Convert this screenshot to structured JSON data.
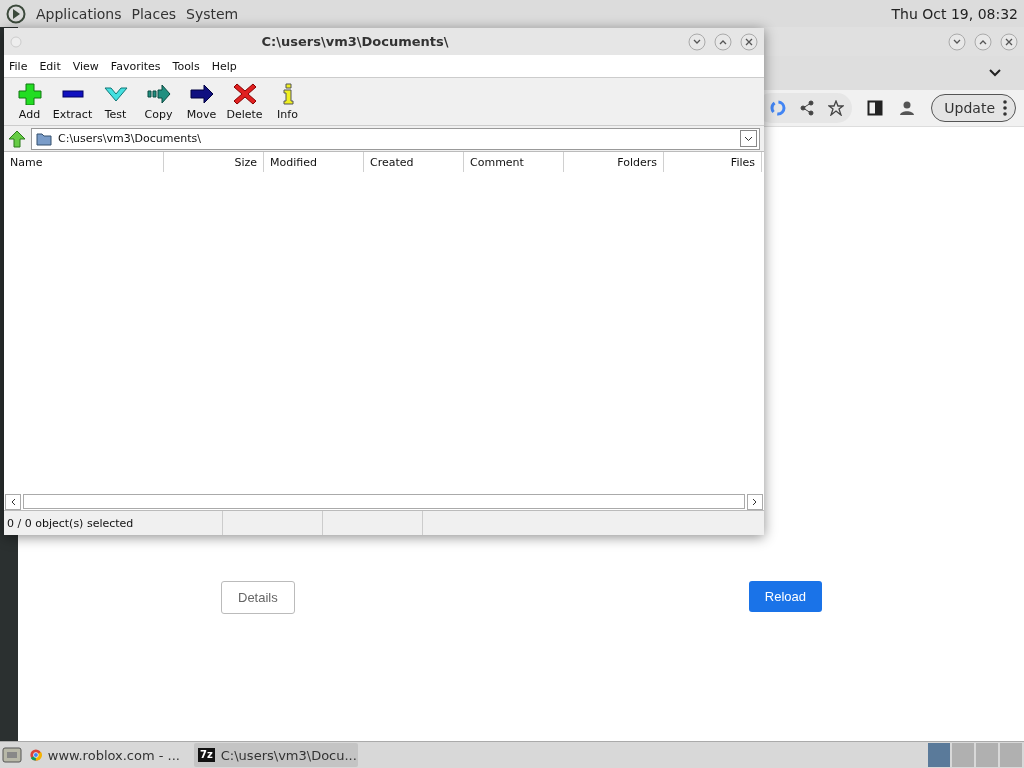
{
  "top_panel": {
    "menus": [
      "Applications",
      "Places",
      "System"
    ],
    "clock": "Thu Oct 19, 08:32"
  },
  "browser": {
    "update_button": "Update",
    "details_button": "Details",
    "reload_button": "Reload"
  },
  "archiver": {
    "title": "C:\\users\\vm3\\Documents\\",
    "menu": [
      "File",
      "Edit",
      "View",
      "Favorites",
      "Tools",
      "Help"
    ],
    "toolbar": [
      {
        "kind": "add",
        "label": "Add"
      },
      {
        "kind": "extract",
        "label": "Extract"
      },
      {
        "kind": "test",
        "label": "Test"
      },
      {
        "kind": "copy",
        "label": "Copy"
      },
      {
        "kind": "move",
        "label": "Move"
      },
      {
        "kind": "delete",
        "label": "Delete"
      },
      {
        "kind": "info",
        "label": "Info"
      }
    ],
    "path": "C:\\users\\vm3\\Documents\\",
    "columns": [
      "Name",
      "Size",
      "Modified",
      "Created",
      "Comment",
      "Folders",
      "Files"
    ],
    "status_bar": "0 / 0 object(s) selected"
  },
  "taskbar": {
    "tasks": [
      {
        "kind": "browser",
        "label": "www.roblox.com - ...",
        "selected": false
      },
      {
        "kind": "archiver",
        "icon_text": "7z",
        "label": "C:\\users\\vm3\\Docu...",
        "selected": true
      }
    ]
  }
}
